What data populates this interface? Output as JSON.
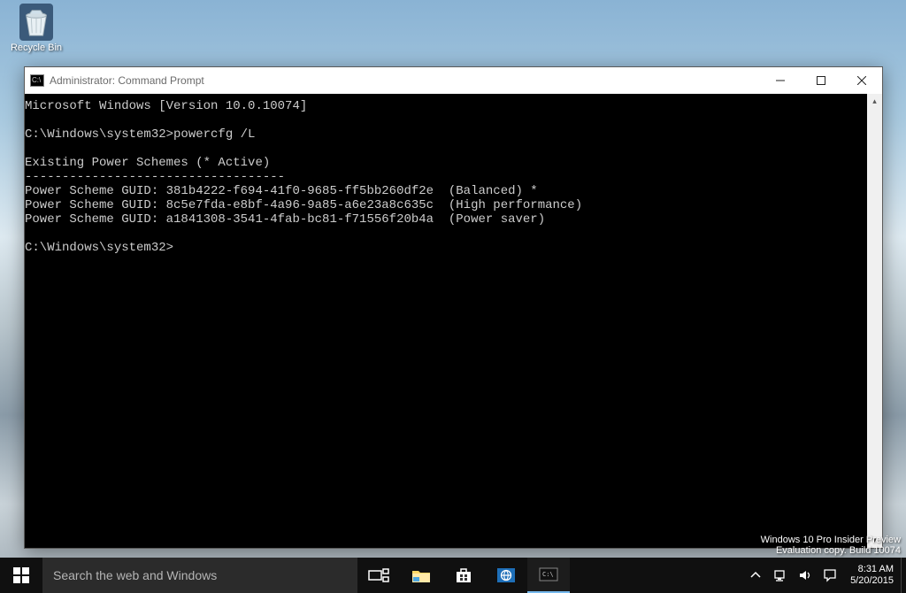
{
  "desktop": {
    "icons": [
      {
        "label": "Recycle Bin"
      }
    ]
  },
  "window": {
    "title": "Administrator: Command Prompt"
  },
  "terminal": {
    "lines": [
      "Microsoft Windows [Version 10.0.10074]",
      "",
      "C:\\Windows\\system32>powercfg /L",
      "",
      "Existing Power Schemes (* Active)",
      "-----------------------------------",
      "Power Scheme GUID: 381b4222-f694-41f0-9685-ff5bb260df2e  (Balanced) *",
      "Power Scheme GUID: 8c5e7fda-e8bf-4a96-9a85-a6e23a8c635c  (High performance)",
      "Power Scheme GUID: a1841308-3541-4fab-bc81-f71556f20b4a  (Power saver)",
      "",
      "C:\\Windows\\system32>"
    ]
  },
  "watermark": {
    "line1": "Windows 10 Pro Insider Preview",
    "line2": "Evaluation copy. Build 10074"
  },
  "taskbar": {
    "search_placeholder": "Search the web and Windows",
    "time": "8:31 AM",
    "date": "5/20/2015"
  }
}
